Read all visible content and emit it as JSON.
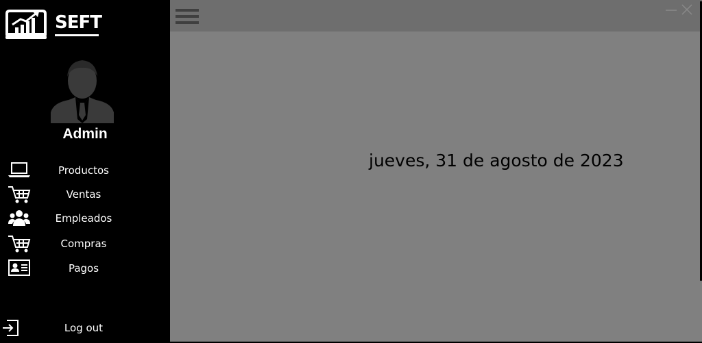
{
  "app": {
    "logo_text": "SEFT"
  },
  "user": {
    "name": "Admin"
  },
  "nav": [
    {
      "label": "Productos",
      "icon": "laptop-icon"
    },
    {
      "label": "Ventas",
      "icon": "cart-icon"
    },
    {
      "label": "Empleados",
      "icon": "users-icon"
    },
    {
      "label": "Compras",
      "icon": "cart-icon"
    },
    {
      "label": "Pagos",
      "icon": "id-card-icon"
    }
  ],
  "logout": {
    "label": "Log out",
    "icon": "logout-icon"
  },
  "main": {
    "date": "jueves, 31 de agosto de 2023"
  },
  "colors": {
    "sidebar": "#000000",
    "main_bg": "#808080",
    "topbar": "#6e6e6e",
    "text_light": "#ffffff"
  }
}
